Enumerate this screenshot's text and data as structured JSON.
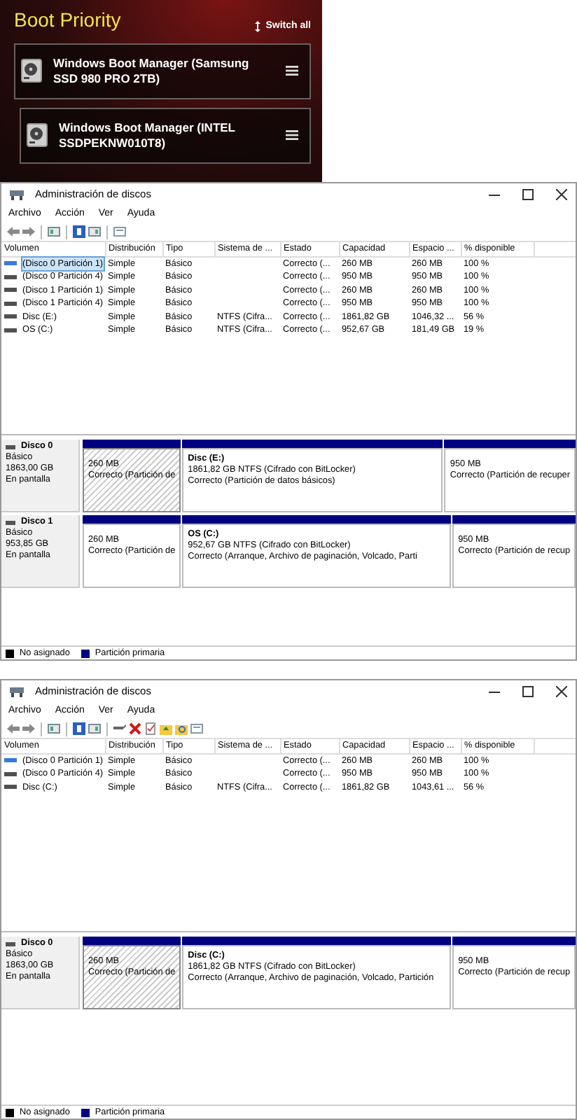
{
  "boot_panel": {
    "title": "Boot Priority",
    "switch_all": "Switch all",
    "entries": [
      {
        "label": "Windows Boot Manager (Samsung SSD 980 PRO 2TB)"
      },
      {
        "label": "Windows Boot Manager (INTEL SSDPEKNW010T8)"
      }
    ]
  },
  "windows": [
    {
      "title": "Administración de discos",
      "menu": [
        "Archivo",
        "Acción",
        "Ver",
        "Ayuda"
      ],
      "toolbar_extended": false,
      "table": {
        "columns": [
          "Volumen",
          "Distribución",
          "Tipo",
          "Sistema de ...",
          "Estado",
          "Capacidad",
          "Espacio ...",
          "% disponible"
        ],
        "rows": [
          {
            "volume": "(Disco 0 Partición 1)",
            "layout": "Simple",
            "type": "Básico",
            "status": "Correcto (...",
            "capacity": "260 MB",
            "free": "260 MB",
            "pct": "100 %",
            "selected": true,
            "color": "#3b78d8"
          },
          {
            "volume": "(Disco 0 Partición 4)",
            "layout": "Simple",
            "type": "Básico",
            "status": "Correcto (...",
            "capacity": "950 MB",
            "free": "950 MB",
            "pct": "100 %",
            "selected": false,
            "color": "#505050"
          },
          {
            "volume": "(Disco 1 Partición 1)",
            "layout": "Simple",
            "type": "Básico",
            "status": "Correcto (...",
            "capacity": "260 MB",
            "free": "260 MB",
            "pct": "100 %",
            "selected": false,
            "color": "#505050"
          },
          {
            "volume": "(Disco 1 Partición 4)",
            "layout": "Simple",
            "type": "Básico",
            "status": "Correcto (...",
            "capacity": "950 MB",
            "free": "950 MB",
            "pct": "100 %",
            "selected": false,
            "color": "#505050"
          },
          {
            "volume": "Disc (E:)",
            "layout": "Simple",
            "type": "Básico",
            "fs": "NTFS (Cifra...",
            "status": "Correcto (...",
            "capacity": "1861,82 GB",
            "free": "1046,32 ...",
            "pct": "56 %",
            "selected": false,
            "color": "#505050"
          },
          {
            "volume": "OS (C:)",
            "layout": "Simple",
            "type": "Básico",
            "fs": "NTFS (Cifra...",
            "status": "Correcto (...",
            "capacity": "952,67 GB",
            "free": "181,49 GB",
            "pct": "19 %",
            "selected": false,
            "color": "#505050"
          }
        ]
      },
      "disks": [
        {
          "name": "Disco 0",
          "type": "Básico",
          "size": "1863,00 GB",
          "status": "En pantalla",
          "partitions": [
            {
              "lines": [
                "260 MB",
                "Correcto (Partición de"
              ],
              "selected": true
            },
            {
              "title": "Disc  (E:)",
              "lines": [
                "1861,82 GB NTFS (Cifrado con BitLocker)",
                "Correcto (Partición de datos básicos)"
              ],
              "selected": false
            },
            {
              "lines": [
                "950 MB",
                "Correcto (Partición de recuper"
              ],
              "selected": false
            }
          ]
        },
        {
          "name": "Disco 1",
          "type": "Básico",
          "size": "953,85 GB",
          "status": "En pantalla",
          "partitions": [
            {
              "lines": [
                "260 MB",
                "Correcto (Partición de"
              ],
              "selected": false
            },
            {
              "title": "OS  (C:)",
              "lines": [
                "952,67 GB NTFS (Cifrado con BitLocker)",
                "Correcto (Arranque, Archivo de paginación, Volcado, Parti"
              ],
              "selected": false
            },
            {
              "lines": [
                "950 MB",
                "Correcto (Partición de recup"
              ],
              "selected": false
            }
          ]
        }
      ],
      "legend": [
        {
          "label": "No asignado",
          "color": "#000000"
        },
        {
          "label": "Partición primaria",
          "color": "#000080"
        }
      ]
    },
    {
      "title": "Administración de discos",
      "menu": [
        "Archivo",
        "Acción",
        "Ver",
        "Ayuda"
      ],
      "toolbar_extended": true,
      "table": {
        "columns": [
          "Volumen",
          "Distribución",
          "Tipo",
          "Sistema de ...",
          "Estado",
          "Capacidad",
          "Espacio ...",
          "% disponible"
        ],
        "rows": [
          {
            "volume": "(Disco 0 Partición 1)",
            "layout": "Simple",
            "type": "Básico",
            "status": "Correcto (...",
            "capacity": "260 MB",
            "free": "260 MB",
            "pct": "100 %",
            "selected": false,
            "color": "#3b78d8"
          },
          {
            "volume": "(Disco 0 Partición 4)",
            "layout": "Simple",
            "type": "Básico",
            "status": "Correcto (...",
            "capacity": "950 MB",
            "free": "950 MB",
            "pct": "100 %",
            "selected": false,
            "color": "#505050"
          },
          {
            "volume": "Disc (C:)",
            "layout": "Simple",
            "type": "Básico",
            "fs": "NTFS (Cifra...",
            "status": "Correcto (...",
            "capacity": "1861,82 GB",
            "free": "1043,61 ...",
            "pct": "56 %",
            "selected": false,
            "color": "#505050"
          }
        ]
      },
      "disks": [
        {
          "name": "Disco 0",
          "type": "Básico",
          "size": "1863,00 GB",
          "status": "En pantalla",
          "partitions": [
            {
              "lines": [
                "260 MB",
                "Correcto (Partición de"
              ],
              "selected": true
            },
            {
              "title": "Disc  (C:)",
              "lines": [
                "1861,82 GB NTFS (Cifrado con BitLocker)",
                "Correcto (Arranque, Archivo de paginación, Volcado, Partición"
              ],
              "selected": false
            },
            {
              "lines": [
                "950 MB",
                "Correcto (Partición de recup"
              ],
              "selected": false
            }
          ]
        }
      ],
      "legend": [
        {
          "label": "No asignado",
          "color": "#000000"
        },
        {
          "label": "Partición primaria",
          "color": "#000080"
        }
      ]
    }
  ]
}
